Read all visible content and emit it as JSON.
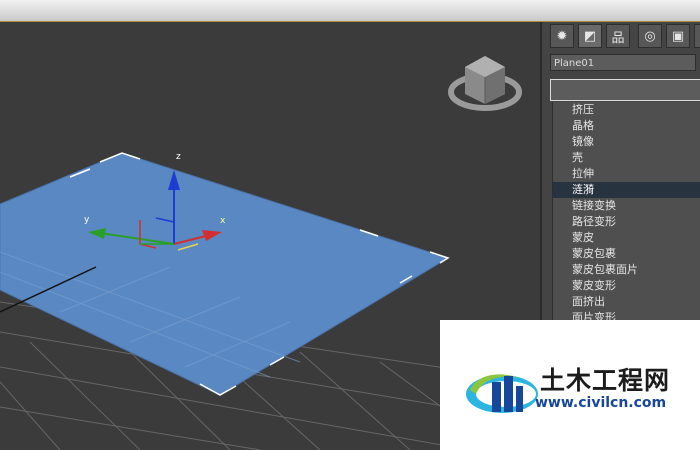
{
  "panel": {
    "tabs": [
      {
        "icon": "sun-icon",
        "glyph": "✹"
      },
      {
        "icon": "modify-icon",
        "glyph": "◩"
      },
      {
        "icon": "hierarchy-icon",
        "glyph": "品"
      },
      {
        "icon": "motion-icon",
        "glyph": "◎"
      },
      {
        "icon": "display-icon",
        "glyph": "▣"
      },
      {
        "icon": "utilities-icon",
        "glyph": "⁄"
      }
    ],
    "object_name": "Plane01",
    "modifier_list": [
      "挤压",
      "晶格",
      "镜像",
      "壳",
      "拉伸",
      "涟漪",
      "链接变换",
      "路径变形",
      "蒙皮",
      "蒙皮包裹",
      "蒙皮包裹面片",
      "蒙皮变形",
      "面挤出",
      "面片变形"
    ],
    "selected_index": 5
  },
  "viewport": {
    "gizmo_axes": {
      "x": "x",
      "y": "y",
      "z": "z"
    },
    "plane_color": "#5a88c3",
    "axis_colors": {
      "x": "#d23030",
      "y": "#28a028",
      "z": "#1e3cd2"
    }
  },
  "watermark": {
    "name": "土木工程网",
    "url": "www.civilcn.com"
  }
}
